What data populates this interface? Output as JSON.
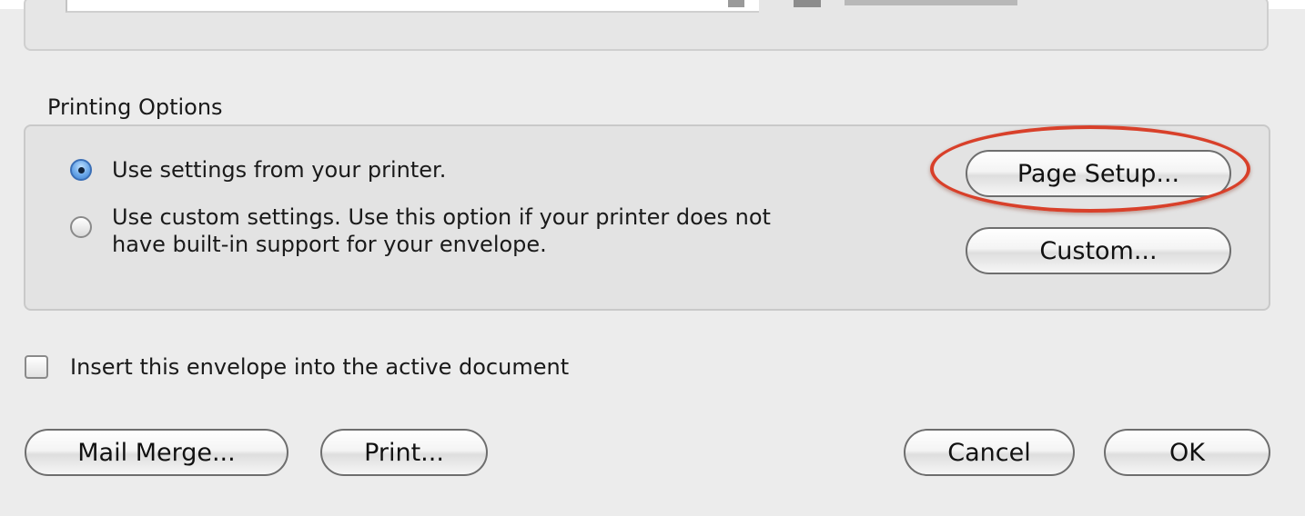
{
  "printing_options": {
    "title": "Printing Options",
    "radio_printer_label": "Use settings from your printer.",
    "radio_custom_line1": "Use custom settings. Use this option if your printer does not",
    "radio_custom_line2": "have built-in support for your envelope.",
    "selected": "printer",
    "page_setup_label": "Page Setup...",
    "custom_label": "Custom..."
  },
  "insert_checkbox": {
    "label": "Insert this envelope into the active document",
    "checked": false
  },
  "footer": {
    "mail_merge_label": "Mail Merge...",
    "print_label": "Print...",
    "cancel_label": "Cancel",
    "ok_label": "OK"
  },
  "annotation": {
    "highlight_color": "#d8402a"
  }
}
